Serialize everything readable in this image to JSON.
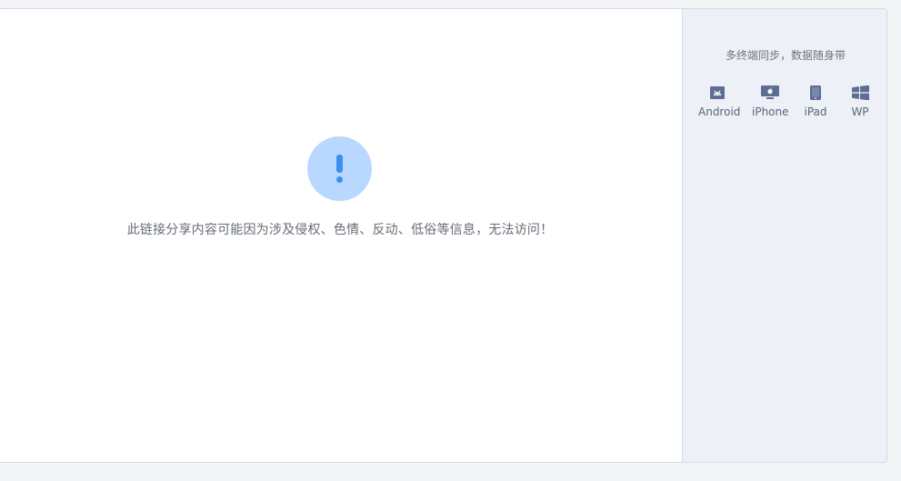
{
  "main": {
    "message": "此链接分享内容可能因为涉及侵权、色情、反动、低俗等信息，无法访问！",
    "icon": "exclamation-icon"
  },
  "sidebar": {
    "title": "多终端同步，数据随身带",
    "platforms": [
      {
        "label": "Android",
        "icon": "android-icon"
      },
      {
        "label": "iPhone",
        "icon": "iphone-icon"
      },
      {
        "label": "iPad",
        "icon": "ipad-icon"
      },
      {
        "label": "WP",
        "icon": "windows-phone-icon"
      }
    ]
  },
  "colors": {
    "accent": "#3d8ff0",
    "alert_bg": "#b8d8ff",
    "sidebar_bg": "#edf1f7",
    "icon": "#5d6d94"
  }
}
